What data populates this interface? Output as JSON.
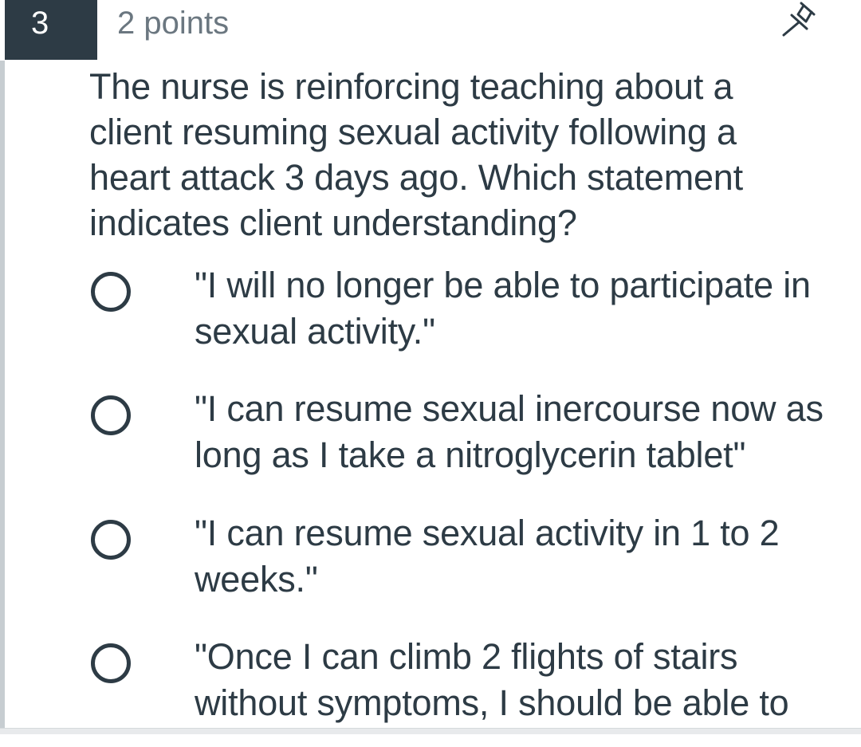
{
  "question": {
    "number": "3",
    "points_label": "2 points",
    "pin_icon": "pushpin-icon",
    "text": "The nurse is reinforcing teaching about a client resuming sexual activity following a heart attack 3 days ago.  Which statement indicates client understanding?"
  },
  "answers": [
    {
      "text": "\"I will no longer be able to participate in sexual activity.\""
    },
    {
      "text": "\"I can resume sexual inercourse now as long as I take a nitroglycerin tablet\""
    },
    {
      "text": "\"I can resume sexual activity in 1 to 2 weeks.\""
    },
    {
      "text": "\"Once I can climb 2 flights of stairs without symptoms, I should be able to"
    }
  ],
  "colors": {
    "header_bg": "#2d3b45",
    "text": "#2d3b45",
    "muted_text": "#6b7780"
  }
}
